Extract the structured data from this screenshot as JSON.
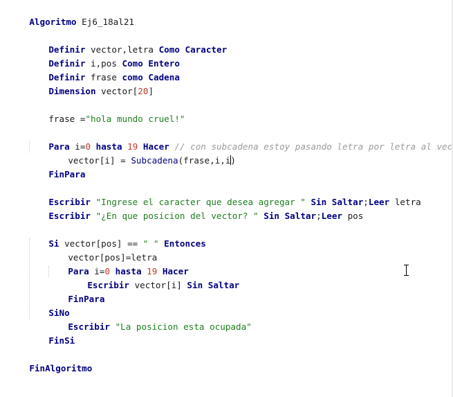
{
  "editor": {
    "l1": {
      "kw": "Algoritmo",
      "name": " Ej6_18al21"
    },
    "l2": {
      "kw1": "Definir",
      "t1": " vector,letra ",
      "kw2": "Como Caracter"
    },
    "l3": {
      "kw1": "Definir",
      "t1": " i,pos ",
      "kw2": "Como Entero"
    },
    "l4": {
      "kw1": "Definir",
      "t1": " frase ",
      "kw2": "como Cadena"
    },
    "l5": {
      "kw": "Dimension",
      "t1": " vector[",
      "num": "20",
      "t2": "]"
    },
    "l6": {
      "t1": "frase =",
      "str": "\"hola mundo cruel!\""
    },
    "l7": {
      "kw1": "Para",
      "t1": " i=",
      "num1": "0",
      "kw2": " hasta ",
      "num2": "19",
      "kw3": " Hacer",
      "cm": " // con subcadena estoy pasando letra por letra al vector"
    },
    "l8": {
      "t1": "vector[i] = ",
      "fn": "Subcadena",
      "t2": "(frase,i,i",
      "t3": ")"
    },
    "l9": {
      "kw": "FinPara"
    },
    "l10": {
      "kw1": "Escribir",
      "str": " \"Ingrese el caracter que desea agregar \"",
      "kw2": " Sin Saltar",
      "t1": ";",
      "kw3": "Leer",
      "t2": " letra"
    },
    "l11": {
      "kw1": "Escribir",
      "str": " \"¿En que posicion del vector? \"",
      "kw2": " Sin Saltar",
      "t1": ";",
      "kw3": "Leer",
      "t2": " pos"
    },
    "l12": {
      "kw1": "Si",
      "t1": " vector[pos] == ",
      "str": "\" \"",
      "kw2": " Entonces"
    },
    "l13": {
      "t1": "vector[pos]=letra"
    },
    "l14": {
      "kw1": "Para",
      "t1": " i=",
      "num1": "0",
      "kw2": " hasta ",
      "num2": "19",
      "kw3": " Hacer"
    },
    "l15": {
      "kw1": "Escribir",
      "t1": " vector[i] ",
      "kw2": "Sin Saltar"
    },
    "l16": {
      "kw": "FinPara"
    },
    "l17": {
      "kw": "SiNo"
    },
    "l18": {
      "kw": "Escribir",
      "str": " \"La posicion esta ocupada\""
    },
    "l19": {
      "kw": "FinSi"
    },
    "l20": {
      "kw": "FinAlgoritmo"
    }
  },
  "colors": {
    "keyword": "#000080",
    "number": "#c0392b",
    "string": "#1e7d1e",
    "comment": "#9a9a9a"
  }
}
